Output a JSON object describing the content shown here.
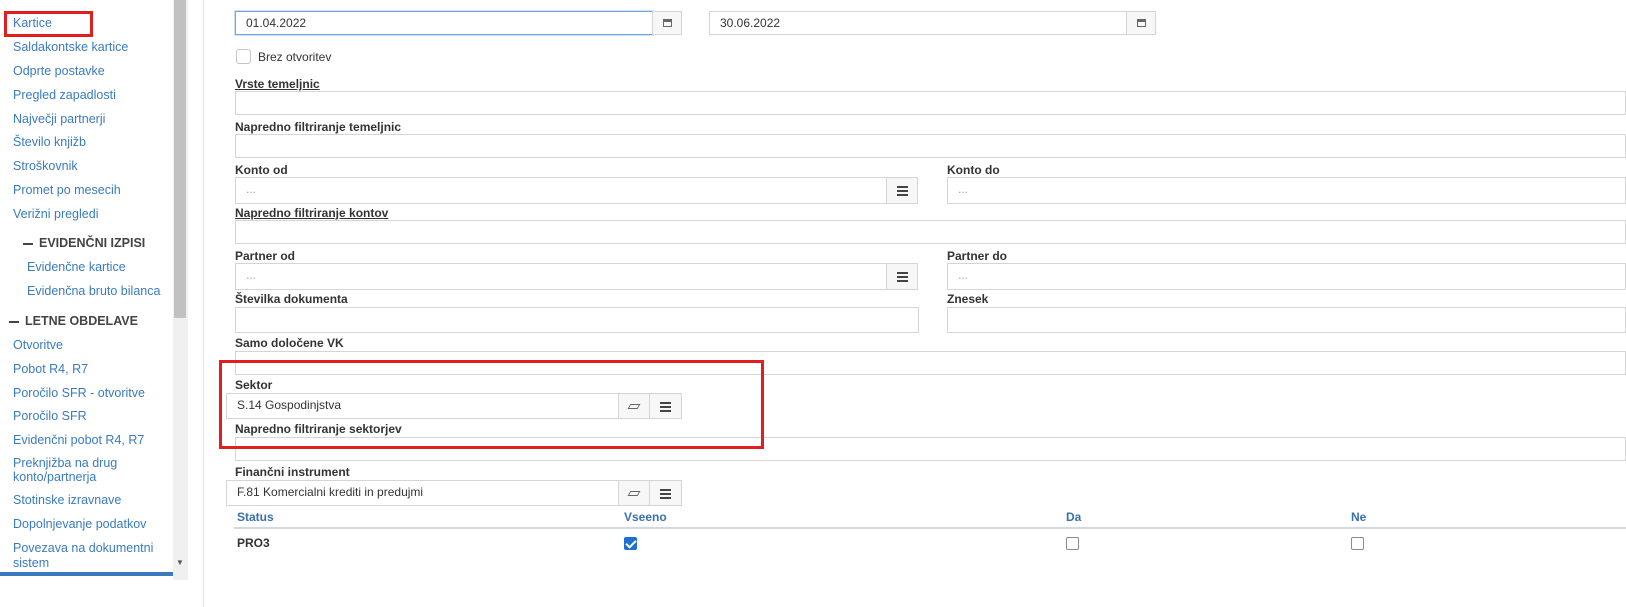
{
  "sidebar": {
    "items": [
      {
        "label": "Kartice"
      },
      {
        "label": "Saldakontske kartice"
      },
      {
        "label": "Odprte postavke"
      },
      {
        "label": "Pregled zapadlosti"
      },
      {
        "label": "Največji partnerji"
      },
      {
        "label": "Število knjižb"
      },
      {
        "label": "Stroškovnik"
      },
      {
        "label": "Promet po mesecih"
      },
      {
        "label": "Verižni pregledi"
      }
    ],
    "section_evidencni": "EVIDENČNI IZPISI",
    "evidencni_items": [
      {
        "label": "Evidenčne kartice"
      },
      {
        "label": "Evidenčna bruto bilanca"
      }
    ],
    "section_letne": "LETNE OBDELAVE",
    "letne_items": [
      {
        "label": "Otvoritve"
      },
      {
        "label": "Pobot R4, R7"
      },
      {
        "label": "Poročilo SFR - otvoritve"
      },
      {
        "label": "Poročilo SFR"
      },
      {
        "label": "Evidenčni pobot R4, R7"
      },
      {
        "label": "Preknjižba na drug"
      },
      {
        "label": "konto/partnerja"
      },
      {
        "label": "Stotinske izravnave"
      },
      {
        "label": "Dopolnjevanje podatkov"
      },
      {
        "label": "Povezava na dokumentni"
      },
      {
        "label": "sistem"
      }
    ]
  },
  "form": {
    "date_from": "01.04.2022",
    "date_to": "30.06.2022",
    "brez_otvoritev": "Brez otvoritev",
    "vrste_temeljnic": "Vrste temeljnic",
    "napredno_temeljnic": "Napredno filtriranje temeljnic",
    "konto_od": "Konto od",
    "konto_do": "Konto do",
    "placeholder_dots": "...",
    "napredno_kontov": "Napredno filtriranje kontov",
    "partner_od": "Partner od",
    "partner_do": "Partner do",
    "stevilka_dokumenta": "Številka dokumenta",
    "znesek": "Znesek",
    "samo_vk": "Samo določene VK",
    "sektor": "Sektor",
    "sektor_value": "S.14 Gospodinjstva",
    "napredno_sektorjev": "Napredno filtriranje sektorjev",
    "financni_instrument": "Finančni instrument",
    "financni_value": "F.81 Komercialni krediti in predujmi"
  },
  "status_table": {
    "headers": [
      "Status",
      "Vseeno",
      "Da",
      "Ne"
    ],
    "rows": [
      {
        "name": "PRO3",
        "vseeno": true,
        "da": false,
        "ne": false
      }
    ]
  },
  "icons": {
    "calendar": "calendar-icon",
    "list": "list-icon",
    "eraser": "eraser-icon"
  },
  "colors": {
    "link": "#3a7bbf",
    "highlight": "#e02020",
    "checked": "#1f6fd1"
  }
}
